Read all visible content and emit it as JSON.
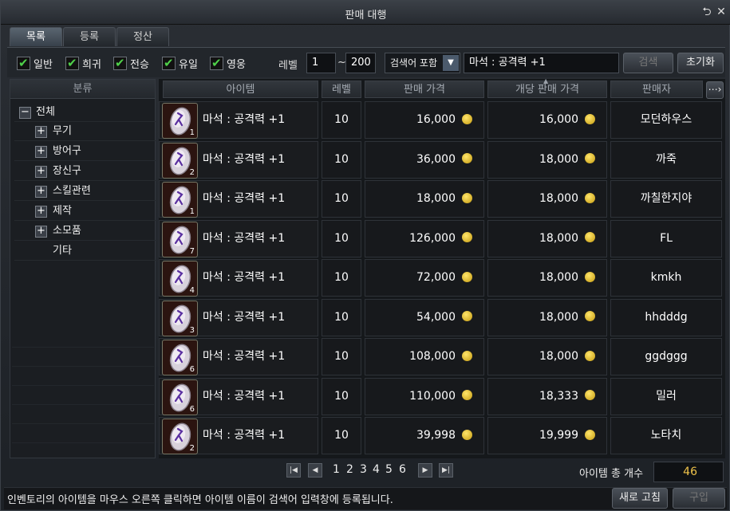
{
  "window": {
    "title": "판매 대행",
    "back_icon": "return-arrow-icon",
    "close_icon": "close-icon"
  },
  "tabs": [
    {
      "label": "목록",
      "active": true
    },
    {
      "label": "등록",
      "active": false
    },
    {
      "label": "정산",
      "active": false
    }
  ],
  "filters": {
    "checkboxes": [
      {
        "label": "일반",
        "checked": true
      },
      {
        "label": "희귀",
        "checked": true
      },
      {
        "label": "전승",
        "checked": true
      },
      {
        "label": "유일",
        "checked": true
      },
      {
        "label": "영웅",
        "checked": true
      }
    ],
    "level_label": "레벨",
    "level_min": "1",
    "level_sep": "~",
    "level_max": "200",
    "search_mode": "검색어 포함",
    "search_text": "마석 : 공격력 +1",
    "search_button": "검색",
    "reset_button": "초기화"
  },
  "categories": {
    "header": "분류",
    "items": [
      {
        "label": "전체",
        "toggle": "−",
        "depth": 0
      },
      {
        "label": "무기",
        "toggle": "+",
        "depth": 1
      },
      {
        "label": "방어구",
        "toggle": "+",
        "depth": 1
      },
      {
        "label": "장신구",
        "toggle": "+",
        "depth": 1
      },
      {
        "label": "스킬관련",
        "toggle": "+",
        "depth": 1
      },
      {
        "label": "제작",
        "toggle": "+",
        "depth": 1
      },
      {
        "label": "소모품",
        "toggle": "+",
        "depth": 1
      },
      {
        "label": "기타",
        "toggle": "",
        "depth": 1
      }
    ]
  },
  "table": {
    "columns": [
      "아이템",
      "레벨",
      "판매 가격",
      "개당 판매 가격",
      "판매자"
    ],
    "more_icon": "arrow-right-icon",
    "rows": [
      {
        "count": "1",
        "name": "마석 : 공격력 +1",
        "level": "10",
        "price": "16,000",
        "unit_price": "16,000",
        "seller": "모던하우스"
      },
      {
        "count": "2",
        "name": "마석 : 공격력 +1",
        "level": "10",
        "price": "36,000",
        "unit_price": "18,000",
        "seller": "까죽"
      },
      {
        "count": "1",
        "name": "마석 : 공격력 +1",
        "level": "10",
        "price": "18,000",
        "unit_price": "18,000",
        "seller": "까칠한지야"
      },
      {
        "count": "7",
        "name": "마석 : 공격력 +1",
        "level": "10",
        "price": "126,000",
        "unit_price": "18,000",
        "seller": "FL"
      },
      {
        "count": "4",
        "name": "마석 : 공격력 +1",
        "level": "10",
        "price": "72,000",
        "unit_price": "18,000",
        "seller": "kmkh"
      },
      {
        "count": "3",
        "name": "마석 : 공격력 +1",
        "level": "10",
        "price": "54,000",
        "unit_price": "18,000",
        "seller": "hhdddg"
      },
      {
        "count": "6",
        "name": "마석 : 공격력 +1",
        "level": "10",
        "price": "108,000",
        "unit_price": "18,000",
        "seller": "ggdggg"
      },
      {
        "count": "6",
        "name": "마석 : 공격력 +1",
        "level": "10",
        "price": "110,000",
        "unit_price": "18,333",
        "seller": "밀러"
      },
      {
        "count": "2",
        "name": "마석 : 공격력 +1",
        "level": "10",
        "price": "39,998",
        "unit_price": "19,999",
        "seller": "노타치"
      }
    ]
  },
  "pager": {
    "first": "|◀",
    "prev": "◀",
    "pages": [
      "1",
      "2",
      "3",
      "4",
      "5",
      "6"
    ],
    "next": "▶",
    "last": "▶|"
  },
  "total": {
    "label": "아이템 총 개수",
    "value": "46"
  },
  "status": {
    "message": "인벤토리의 아이템을 마우스 오른쪽 클릭하면 아이템 이름이 검색어 입력창에 등록됩니다."
  },
  "buttons": {
    "refresh": "새로 고침",
    "buy": "구입"
  },
  "colors": {
    "accent_gold": "#f0c34a",
    "check_green": "#4fd04a"
  }
}
